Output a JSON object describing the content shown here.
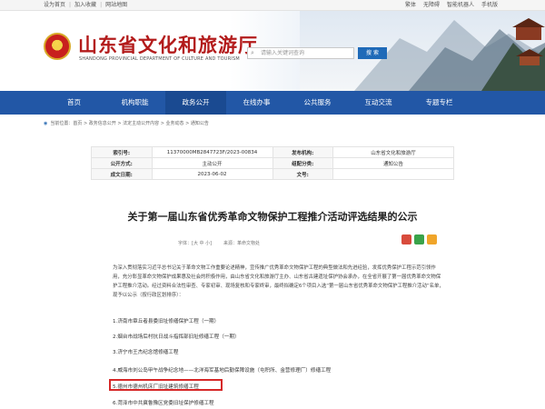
{
  "topbar": {
    "left_links": [
      "设为首页",
      "加入收藏",
      "网站地图"
    ],
    "right_links": [
      "繁体",
      "无障碍",
      "智能机器人",
      "手机版"
    ]
  },
  "header": {
    "title": "山东省文化和旅游厅",
    "subtitle": "SHANDONG PROVINCIAL DEPARTMENT OF CULTURE AND TOURISM",
    "search_placeholder": "请输入关键词查询",
    "search_button": "搜 索"
  },
  "nav": {
    "items": [
      "首页",
      "机构职能",
      "政务公开",
      "在线办事",
      "公共服务",
      "互动交流",
      "专题专栏"
    ]
  },
  "breadcrumb": "当前位置：首页 > 政务信息公开 > 法定主动公开内容 > 业务动态 > 通知公告",
  "meta": {
    "index_no_label": "索引号:",
    "index_no": "11370000MB2847723F/2023-00834",
    "issuer_label": "发布机构:",
    "issuer": "山东省文化和旅游厅",
    "mode_label": "公开方式:",
    "mode": "主动公开",
    "category_label": "组配分类:",
    "category": "通知公告",
    "date_label": "成文日期:",
    "date": "2023-06-02",
    "docno_label": "文号:",
    "docno": ""
  },
  "article": {
    "title": "关于第一届山东省优秀革命文物保护工程推介活动评选结果的公示",
    "font_size": "字体：[大 中 小]",
    "source": "来源：革命文物处",
    "intro": "为深入贯彻落实习近平总书记关于革命文物工作重要论述精神，宣传推广优秀革命文物保护工程的典型做法和先进经验，发挥优秀保护工程示范引领作用，充分彰显革命文物保护成果惠及社会的积极作用，由山东省文化和旅游厅主办、山东省古建遗址保护协会承办，在全省开展了第一届优秀革命文物保护工程推介活动。经过资料合法性审查、专家初审、现场复核和专家终审，最终拟确定6个项目入选“第一届山东省优秀革命文物保护工程推介活动”名单，现予以公示（按行政区划排序）：",
    "list": [
      "1.济南市章丘者县委旧址修缮保护工程（一期）",
      "2.烟台市战场后村抗日战斗指挥部旧址修缮工程（一期）",
      "3.济宁市王杰纪念馆修缮工程",
      "4.威海市刘公岛甲午战争纪念地——北洋海军基地后勤保障设施（屯积所、金营修理厂）修缮工程",
      "5.德州市德州机床厂旧址建筑修缮工程",
      "6.菏泽市中共冀鲁豫区党委旧址保护修缮工程"
    ]
  },
  "colors": {
    "brand_red": "#b31b1b",
    "nav_blue": "#2257a6",
    "highlight_red": "#d62828"
  }
}
